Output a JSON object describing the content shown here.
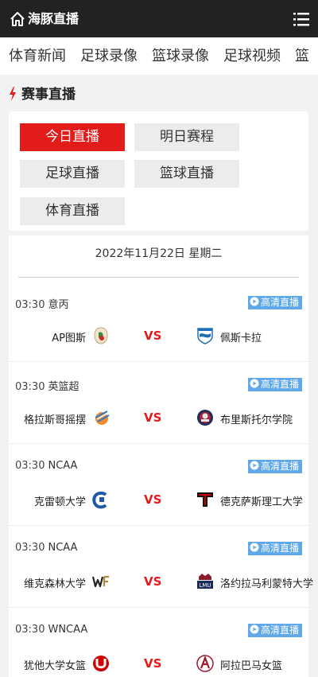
{
  "header": {
    "brand": "海豚直播",
    "home_icon": "home-icon",
    "menu_icon": "menu-icon"
  },
  "nav": [
    "体育新闻",
    "足球录像",
    "篮球录像",
    "足球视频",
    "篮"
  ],
  "section": {
    "title": "赛事直播"
  },
  "tabs": [
    {
      "label": "今日直播",
      "active": true
    },
    {
      "label": "明日赛程",
      "active": false
    },
    {
      "label": "足球直播",
      "active": false
    },
    {
      "label": "篮球直播",
      "active": false
    },
    {
      "label": "体育直播",
      "active": false
    }
  ],
  "date_label": "2022年11月22日 星期二",
  "badge_label": "高清直播",
  "vs_label": "VS",
  "colors": {
    "accent": "#e21b1b",
    "badge": "#5fa9ea",
    "topbar": "#222222"
  },
  "matches": [
    {
      "time": "03:30",
      "league": "意丙",
      "home": "AP图斯",
      "away": "佩斯卡拉"
    },
    {
      "time": "03:30",
      "league": "英篮超",
      "home": "格拉斯哥摇摆",
      "away": "布里斯托尔学院"
    },
    {
      "time": "03:30",
      "league": "NCAA",
      "home": "克雷顿大学",
      "away": "德克萨斯理工大学"
    },
    {
      "time": "03:30",
      "league": "NCAA",
      "home": "维克森林大学",
      "away": "洛约拉马利蒙特大学"
    },
    {
      "time": "03:30",
      "league": "WNCAA",
      "home": "犹他大学女篮",
      "away": "阿拉巴马女篮"
    }
  ]
}
